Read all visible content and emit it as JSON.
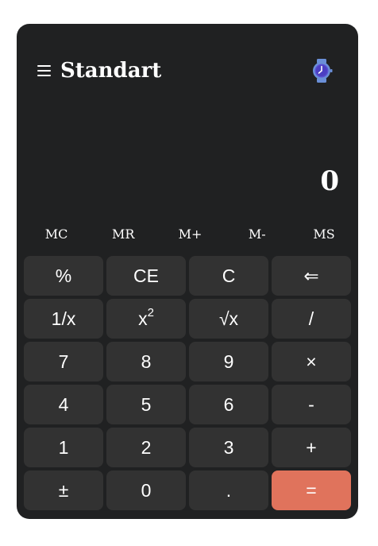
{
  "header": {
    "title": "Standart",
    "menu_icon": "hamburger-menu-icon",
    "history_icon": "watch-history-icon"
  },
  "display": {
    "value": "0"
  },
  "memory": [
    "MC",
    "MR",
    "M+",
    "M-",
    "MS"
  ],
  "keys": {
    "percent": "%",
    "ce": "CE",
    "c": "C",
    "backspace": "⇐",
    "reciprocal": "1/x",
    "square_base": "x",
    "square_exp": "2",
    "sqrt": "√x",
    "divide": "/",
    "seven": "7",
    "eight": "8",
    "nine": "9",
    "multiply": "×",
    "four": "4",
    "five": "5",
    "six": "6",
    "minus": "-",
    "one": "1",
    "two": "2",
    "three": "3",
    "plus": "+",
    "negate": "±",
    "zero": "0",
    "decimal": ".",
    "equals": "="
  },
  "colors": {
    "background": "#202122",
    "key": "#323232",
    "equals": "#e0735c",
    "text": "#ffffff",
    "watch_face": "#5a4fd1"
  }
}
